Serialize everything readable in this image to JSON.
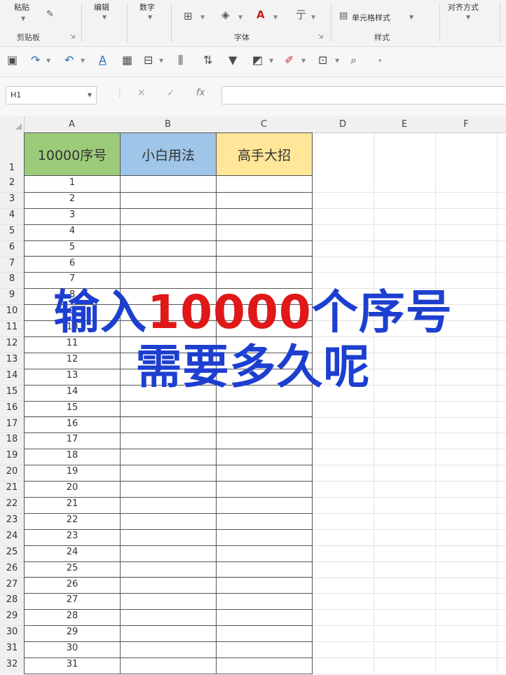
{
  "ribbon": {
    "paste_label": "粘贴",
    "clipboard_label": "剪贴板",
    "edit_label": "编辑",
    "number_label": "数字",
    "font_label": "字体",
    "cell_style_label": "单元格样式",
    "style_label": "样式",
    "align_label": "对齐方式"
  },
  "namebox": {
    "value": "H1"
  },
  "formula_bar": {
    "fx": "fx",
    "value": ""
  },
  "columns": [
    "A",
    "B",
    "C",
    "D",
    "E",
    "F"
  ],
  "headers": {
    "a": "10000序号",
    "b": "小白用法",
    "c": "高手大招",
    "a_color": "#9ccc7a",
    "b_color": "#9fc5e8",
    "c_color": "#ffe699"
  },
  "row_numbers": [
    "1",
    "2",
    "3",
    "4",
    "5",
    "6",
    "7",
    "8",
    "9",
    "10",
    "11",
    "12",
    "13",
    "14",
    "15",
    "16",
    "17",
    "18",
    "19",
    "20",
    "21",
    "22",
    "23",
    "24",
    "25",
    "26",
    "27",
    "28",
    "29",
    "30",
    "31",
    "32"
  ],
  "sequence_values": [
    "1",
    "2",
    "3",
    "4",
    "5",
    "6",
    "7",
    "8",
    "9",
    "10",
    "11",
    "12",
    "13",
    "14",
    "15",
    "16",
    "17",
    "18",
    "19",
    "20",
    "21",
    "22",
    "23",
    "24",
    "25",
    "26",
    "27",
    "28",
    "29",
    "30",
    "31"
  ],
  "overlay": {
    "line1_a": "输入",
    "line1_highlight": "10000",
    "line1_b": "个序号",
    "line2": "需要多久呢",
    "main_color": "#1d3fd0",
    "highlight_color": "#e01818"
  }
}
